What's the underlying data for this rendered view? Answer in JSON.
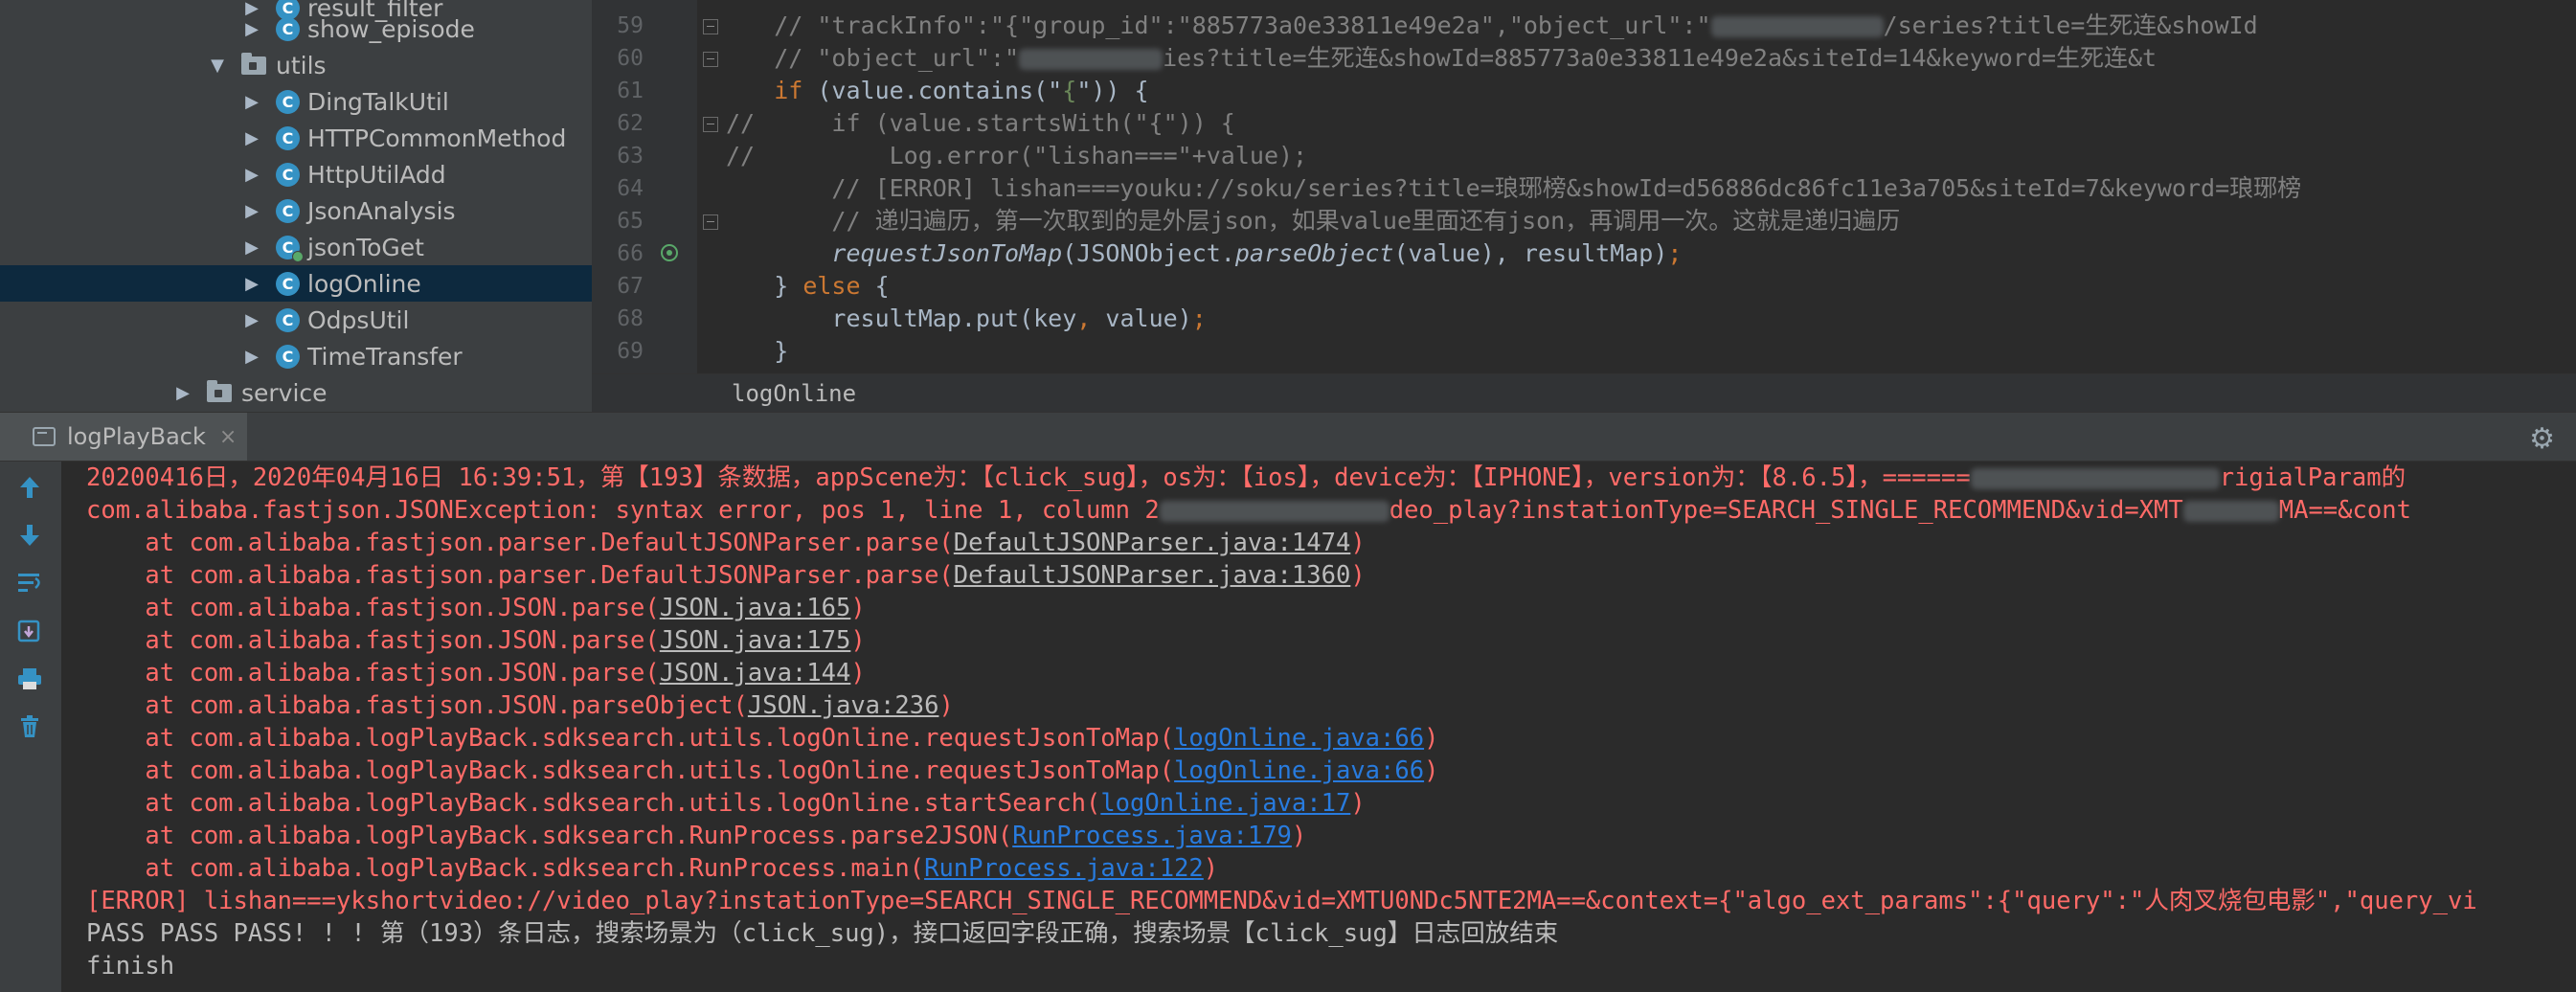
{
  "project_tree": {
    "items": [
      {
        "label": "result_filter",
        "kind": "class"
      },
      {
        "label": "show_episode",
        "kind": "class"
      },
      {
        "label": "utils",
        "kind": "folder"
      },
      {
        "label": "DingTalkUtil",
        "kind": "class"
      },
      {
        "label": "HTTPCommonMethod",
        "kind": "class"
      },
      {
        "label": "HttpUtilAdd",
        "kind": "class"
      },
      {
        "label": "JsonAnalysis",
        "kind": "class"
      },
      {
        "label": "jsonToGet",
        "kind": "class"
      },
      {
        "label": "logOnline",
        "kind": "class"
      },
      {
        "label": "OdpsUtil",
        "kind": "class"
      },
      {
        "label": "TimeTransfer",
        "kind": "class"
      },
      {
        "label": "service",
        "kind": "folder"
      }
    ],
    "class_icon_letter": "C"
  },
  "editor": {
    "line_numbers": [
      "59",
      "60",
      "61",
      "62",
      "63",
      "64",
      "65",
      "66",
      "67",
      "68",
      "69"
    ],
    "code": {
      "l59_a": "    // \"trackInfo\":\"{\"group_id\":\"885773a0e33811e49e2a\",\"object_url\":\"",
      "l59_b": "/series?title=生死连&showId",
      "l60_a": "    // \"object_url\":\"",
      "l60_b": "ies?title=生死连&showId=885773a0e33811e49e2a&siteId=14&keyword=生死连&t",
      "l61_kw": "    if",
      "l61_a": " (value.contains(\"",
      "l61_str": "{",
      "l61_b": "\")) {",
      "l62_com": "//",
      "l62_a": "        if (value.startsWith(\"{\")) {",
      "l63_com": "//",
      "l63_a": "            Log.error(\"lishan===\"+value);",
      "l64": "        // [ERROR] lishan===youku://soku/series?title=琅琊榜&showId=d56886dc86fc11e3a705&siteId=7&keyword=琅琊榜",
      "l65": "        // 递归遍历，第一次取到的是外层json，如果value里面还有json，再调用一次。这就是递归遍历",
      "l66_fn": "        requestJsonToMap",
      "l66_a": "(JSONObject.",
      "l66_it": "parseObject",
      "l66_b": "(value), resultMap)",
      "l66_semi": ";",
      "l67_a": "    } ",
      "l67_kw": "else",
      "l67_b": " {",
      "l68_a": "        resultMap.put(key",
      "l68_comma": ",",
      "l68_b": " value)",
      "l68_semi": ";",
      "l69": "    }"
    },
    "breadcrumb": "logOnline"
  },
  "run_panel": {
    "tab_label": "logPlayBack",
    "tab_close": "×",
    "settings_icon": "⚙",
    "console": {
      "line1_a": "20200416日，2020年04月16日 16:39:51，第【193】条数据，appScene为：【click_sug】，os为：【ios】，device为：【IPHONE】，version为：【8.6.5】，======",
      "line1_b": "rigialParam的",
      "line2_a": "com.alibaba.fastjson.JSONException: syntax error, pos 1, line 1, column 2",
      "line2_b": "deo_play?instationType=SEARCH_SINGLE_RECOMMEND&vid=XMT",
      "line2_c": "MA==&cont",
      "st1_a": "    at com.alibaba.fastjson.parser.DefaultJSONParser.parse(",
      "st1_link": "DefaultJSONParser.java:1474",
      "st2_a": "    at com.alibaba.fastjson.parser.DefaultJSONParser.parse(",
      "st2_link": "DefaultJSONParser.java:1360",
      "st3_a": "    at com.alibaba.fastjson.JSON.parse(",
      "st3_link": "JSON.java:165",
      "st4_a": "    at com.alibaba.fastjson.JSON.parse(",
      "st4_link": "JSON.java:175",
      "st5_a": "    at com.alibaba.fastjson.JSON.parse(",
      "st5_link": "JSON.java:144",
      "st6_a": "    at com.alibaba.fastjson.JSON.parseObject(",
      "st6_link": "JSON.java:236",
      "st7_a": "    at com.alibaba.logPlayBack.sdksearch.utils.logOnline.requestJsonToMap(",
      "st7_link": "logOnline.java:66",
      "st8_a": "    at com.alibaba.logPlayBack.sdksearch.utils.logOnline.requestJsonToMap(",
      "st8_link": "logOnline.java:66",
      "st9_a": "    at com.alibaba.logPlayBack.sdksearch.utils.logOnline.startSearch(",
      "st9_link": "logOnline.java:17",
      "st10_a": "    at com.alibaba.logPlayBack.sdksearch.RunProcess.parse2JSON(",
      "st10_link": "RunProcess.java:179",
      "st11_a": "    at com.alibaba.logPlayBack.sdksearch.RunProcess.main(",
      "st11_link": "RunProcess.java:122",
      "close_paren": ")",
      "error_line": "[ERROR] lishan===ykshortvideo://video_play?instationType=SEARCH_SINGLE_RECOMMEND&vid=XMTU0NDc5NTE2MA==&context={\"algo_ext_params\":{\"query\":\"人肉叉烧包电影\",\"query_vi",
      "pass_line": "PASS PASS PASS! ! ! 第（193）条日志，搜索场景为（click_sug)，接口返回字段正确，搜索场景【click_sug】日志回放结束",
      "finish_line": "finish"
    }
  },
  "colors": {
    "error_text": "#ff6b68",
    "link_blue": "#287bde",
    "selection": "#0d293e"
  }
}
